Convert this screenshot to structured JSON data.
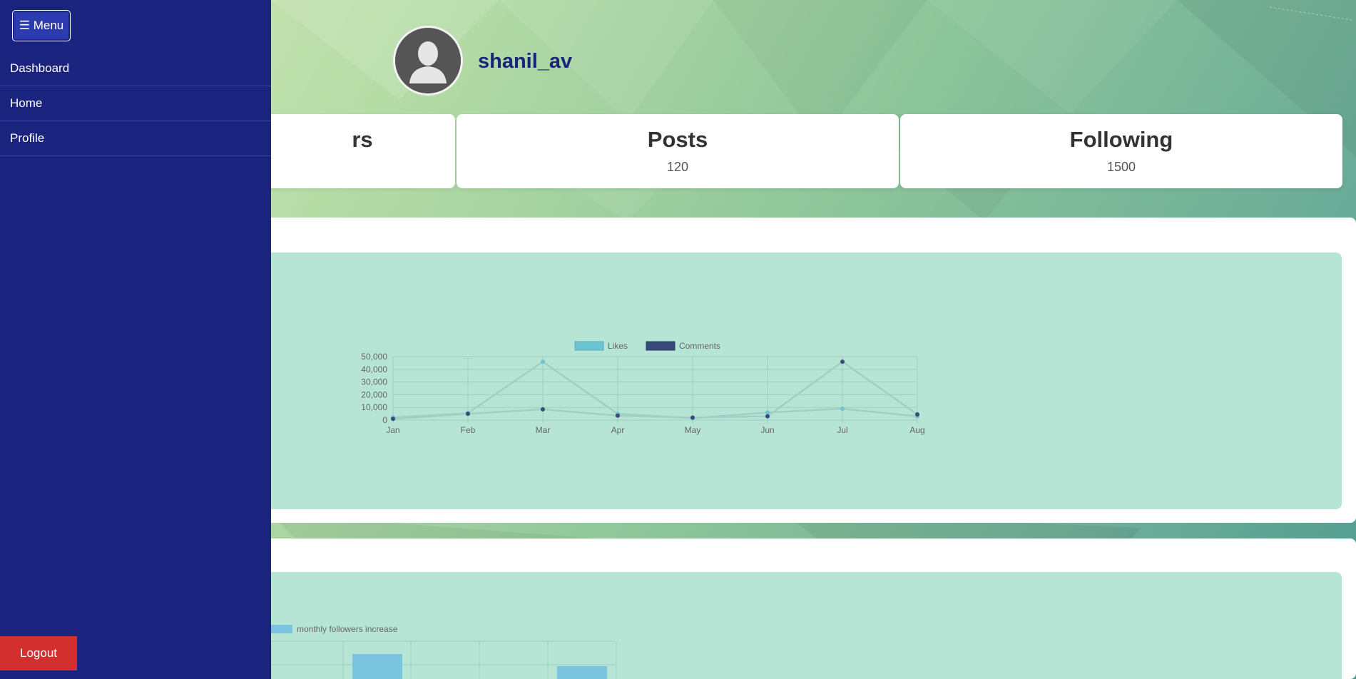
{
  "menu": {
    "button_label": "☰ Menu",
    "items": [
      "Dashboard",
      "Home",
      "Profile"
    ],
    "logout_label": "Logout"
  },
  "profile": {
    "username": "shanil_av"
  },
  "stats": [
    {
      "title": "Followers",
      "visible_title": "rs",
      "value": ""
    },
    {
      "title": "Posts",
      "value": "120"
    },
    {
      "title": "Following",
      "value": "1500"
    }
  ],
  "colors": {
    "sidebar": "#1a237e",
    "logout": "#d32f2f",
    "likes": "#6cc3d1",
    "comments": "#3a4a78",
    "chart_bg": "#b6e5d6"
  },
  "chart_data": [
    {
      "type": "line",
      "categories": [
        "Jan",
        "Feb",
        "Mar",
        "Apr",
        "May",
        "Jun",
        "Jul",
        "Aug"
      ],
      "series": [
        {
          "name": "Likes",
          "values": [
            2000,
            5500,
            46000,
            5000,
            1500,
            6000,
            9000,
            3000
          ]
        },
        {
          "name": "Comments",
          "values": [
            1000,
            5000,
            8500,
            3500,
            2000,
            3000,
            46000,
            4500
          ]
        }
      ],
      "yticks": [
        "50,000",
        "40,000",
        "30,000",
        "20,000",
        "10,000",
        "0"
      ],
      "ylim": [
        0,
        50000
      ],
      "legend": "top"
    },
    {
      "type": "bar",
      "series": [
        {
          "name": "monthly followers increase"
        }
      ],
      "legend": "top"
    }
  ]
}
